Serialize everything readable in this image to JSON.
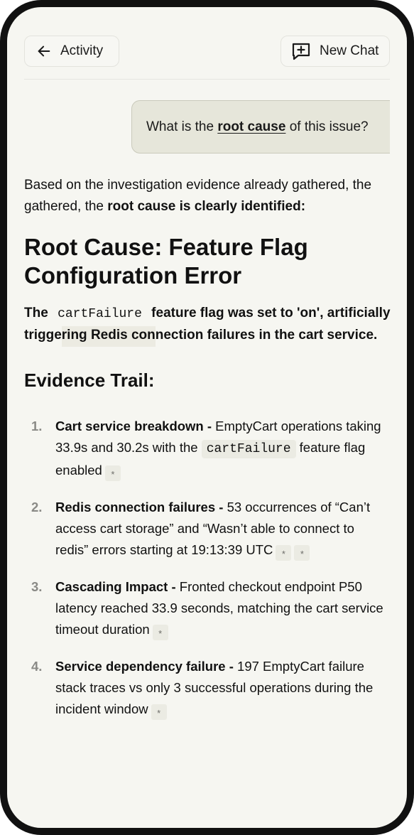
{
  "header": {
    "back_label": "Activity",
    "new_chat_label": "New Chat"
  },
  "user_message": {
    "pre": "What is the ",
    "emphasis": "root cause",
    "post": " of this issue?"
  },
  "response": {
    "intro_text": "Based on the investigation evidence already gathered, the gathered, the ",
    "intro_bold": "root cause is clearly identified:",
    "heading": "Root Cause: Feature Flag Configuration Error",
    "summary_pre": "The ",
    "summary_code": "cartFailure",
    "summary_mid1": " feature flag was set to 'on', artificially trigge",
    "summary_highlight": "ring Redis con",
    "summary_post": "nection failures in the cart service.",
    "evidence_heading": "Evidence Trail:",
    "items": [
      {
        "num": "1.",
        "title": "Cart service breakdown - ",
        "text1": "EmptyCart operations taking 33.9s and 30.2s with the ",
        "code": "cartFailure",
        "text2": " feature flag enabled",
        "stars": [
          "*"
        ]
      },
      {
        "num": "2.",
        "title": "Redis connection failures - ",
        "text1": "53 occurrences of “Can’t access cart storage” and “Wasn’t able to connect to redis”  errors starting at 19:13:39 UTC",
        "stars": [
          "*",
          "*"
        ]
      },
      {
        "num": "3.",
        "title": "Cascading Impact - ",
        "text1": "Fronted checkout endpoint P50 latency reached 33.9 seconds, matching the cart service timeout duration",
        "stars": [
          "*"
        ]
      },
      {
        "num": "4.",
        "title": "Service dependency failure - ",
        "text1": "197 EmptyCart failure stack traces vs only 3 successful operations during the incident window",
        "stars": [
          "*"
        ]
      }
    ]
  }
}
